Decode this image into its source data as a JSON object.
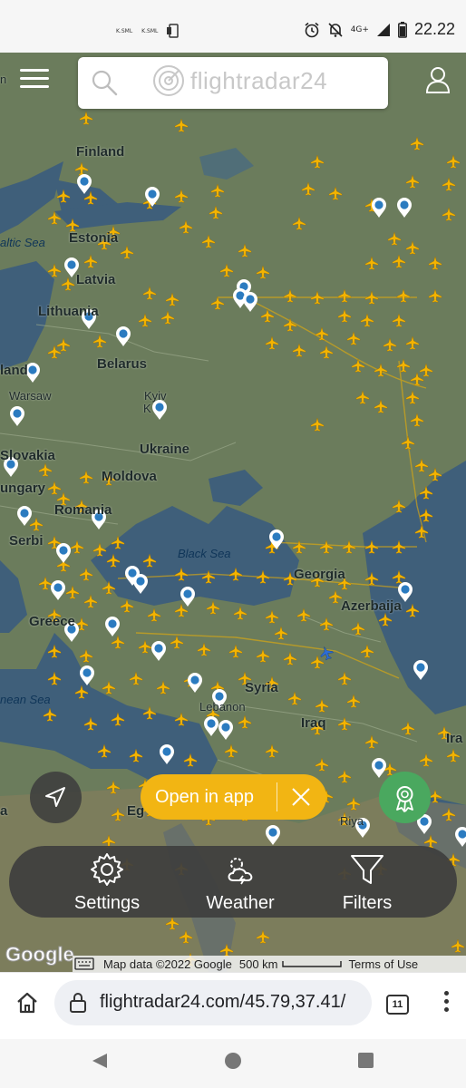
{
  "status_bar": {
    "time": "22.22",
    "network": "4G+",
    "left_labels": [
      "K.SML",
      "K.SML"
    ],
    "icons": [
      "alarm-icon",
      "mute-icon",
      "signal-icon",
      "battery-icon"
    ]
  },
  "header": {
    "logo_text": "flightradar24",
    "icons": [
      "menu-icon",
      "search-icon",
      "user-icon"
    ]
  },
  "map": {
    "labels": {
      "finland": "Finland",
      "estonia": "Estonia",
      "baltic_sea": "altic Sea",
      "latvia": "Latvia",
      "lithuania": "Lithuania",
      "poland": "land",
      "belarus": "Belarus",
      "warsaw": "Warsaw",
      "kyiv": "Kyiv",
      "kyiv_line2": "K",
      "ukraine": "Ukraine",
      "slovakia": "Slovakia",
      "hungary": "ungary",
      "moldova": "Moldova",
      "romania": "Romania",
      "serbia": "Serbi",
      "black_sea": "Black Sea",
      "georgia": "Georgia",
      "azerbaijan": "Azerbaija",
      "greece": "Greece",
      "med_sea": "nean Sea",
      "syria": "Syria",
      "lebanon": "Lebanon",
      "iraq": "Iraq",
      "ira": "Ira",
      "egypt": "Eg",
      "a": "a",
      "riyadh": "Riya",
      "n_top": "n"
    },
    "colors": {
      "land": "#6b7c5c",
      "water": "#3f5f7a",
      "plane": "#f4b400",
      "marker": "#2b7bc0"
    }
  },
  "controls": {
    "open_in_app_label": "Open in app",
    "bottom_panel": {
      "settings_label": "Settings",
      "weather_label": "Weather",
      "filters_label": "Filters"
    }
  },
  "attribution": {
    "google": "Google",
    "map_data": "Map data ©2022 Google",
    "scale": "500 km",
    "terms": "Terms of Use"
  },
  "browser": {
    "url": "flightradar24.com/45.79,37.41/",
    "tab_count": "11"
  }
}
